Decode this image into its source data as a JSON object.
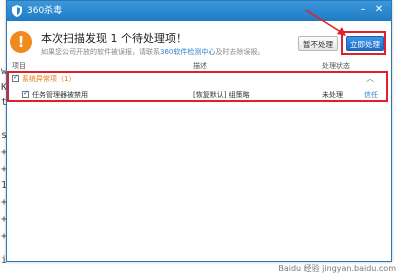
{
  "background_fragments": [
    "w",
    "K",
    "t",
    "s",
    "+",
    "+",
    "1",
    "+",
    "+",
    "+",
    "i"
  ],
  "window": {
    "title": "360杀毒",
    "minimize_symbol": "–",
    "close_symbol": "✕"
  },
  "alert": {
    "icon_symbol": "!",
    "headline": "本次扫描发现 1 个待处理项！",
    "subline_prefix": "如果您公司开放的软件被误报，请联系",
    "subline_link": "360软件检测中心",
    "subline_suffix": "及时去除误报。",
    "ignore_button": "暂不处理",
    "process_button": "立即处理"
  },
  "table": {
    "columns": [
      "项目",
      "描述",
      "处理状态"
    ],
    "category": {
      "label": "系统异常项",
      "count": "（1）"
    },
    "rows": [
      {
        "name": "任务管理器被禁用",
        "description": "[恢复默认] 组策略",
        "status": "未处理",
        "action": "信任"
      }
    ]
  },
  "colors": {
    "title_bar": "#2a88d2",
    "process_button": "#2577d4",
    "highlight": "#e0202a",
    "category_text": "#e07a10",
    "alert_icon": "#f08a1c"
  },
  "watermark": "Baidu 经验 jingyan.baidu.com"
}
